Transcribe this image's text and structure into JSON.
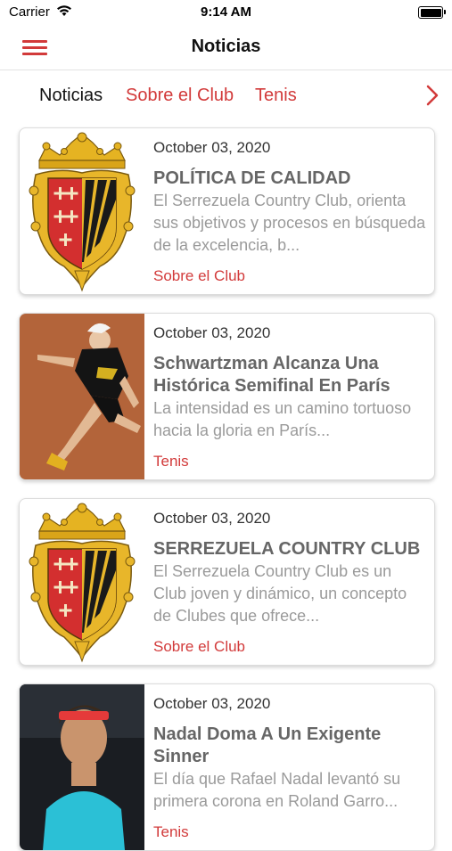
{
  "status_bar": {
    "carrier": "Carrier",
    "time": "9:14 AM"
  },
  "navbar": {
    "title": "Noticias"
  },
  "tabs": [
    {
      "label": "Noticias",
      "active": true
    },
    {
      "label": "Sobre el Club",
      "active": false
    },
    {
      "label": "Tenis",
      "active": false
    }
  ],
  "articles": [
    {
      "date": "October 03, 2020",
      "title": "POLÍTICA DE CALIDAD",
      "excerpt": "El Serrezuela Country Club, orienta sus objetivos y procesos en búsqueda de la excelencia, b...",
      "category": "Sobre el Club",
      "image": "club-crest"
    },
    {
      "date": "October 03, 2020",
      "title": "Schwartzman Alcanza Una Histórica Semifinal En París",
      "excerpt": "La intensidad es un camino tortuoso hacia la gloria en París...",
      "category": "Tenis",
      "image": "tennis-player-clay-court"
    },
    {
      "date": "October 03, 2020",
      "title": "SERREZUELA COUNTRY CLUB",
      "excerpt": "El Serrezuela Country Club es un Club joven y dinámico, un concepto de Clubes que ofrece...",
      "category": "Sobre el Club",
      "image": "club-crest"
    },
    {
      "date": "October 03, 2020",
      "title": "Nadal Doma A Un Exigente Sinner",
      "excerpt": "El día que Rafael Nadal levantó su primera corona en Roland Garro...",
      "category": "Tenis",
      "image": "tennis-player-portrait"
    }
  ],
  "colors": {
    "accent": "#d23a3a",
    "title_gray": "#666666",
    "excerpt_gray": "#9a9a9a"
  }
}
